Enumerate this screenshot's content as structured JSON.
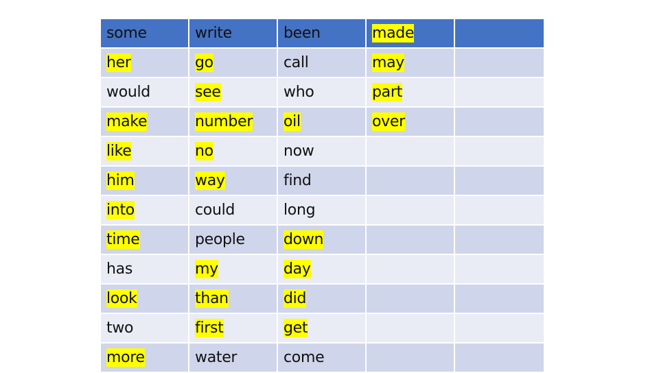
{
  "colors": {
    "header_bg": "#4472c4",
    "row_dark_bg": "#cfd5ea",
    "row_light_bg": "#e9ebf5",
    "highlight": "#ffff00"
  },
  "table": {
    "rows": [
      [
        {
          "text": "some",
          "hl": false
        },
        {
          "text": "write",
          "hl": false
        },
        {
          "text": "been",
          "hl": false
        },
        {
          "text": "made",
          "hl": true
        },
        {
          "text": "",
          "hl": false
        }
      ],
      [
        {
          "text": "her",
          "hl": true
        },
        {
          "text": "go",
          "hl": true
        },
        {
          "text": "call",
          "hl": false
        },
        {
          "text": "may",
          "hl": true
        },
        {
          "text": "",
          "hl": false
        }
      ],
      [
        {
          "text": "would",
          "hl": false
        },
        {
          "text": "see",
          "hl": true
        },
        {
          "text": "who",
          "hl": false
        },
        {
          "text": "part",
          "hl": true
        },
        {
          "text": "",
          "hl": false
        }
      ],
      [
        {
          "text": "make",
          "hl": true
        },
        {
          "text": "number",
          "hl": true
        },
        {
          "text": "oil",
          "hl": true
        },
        {
          "text": "over",
          "hl": true
        },
        {
          "text": "",
          "hl": false
        }
      ],
      [
        {
          "text": "like",
          "hl": true
        },
        {
          "text": "no",
          "hl": true
        },
        {
          "text": "now",
          "hl": false
        },
        {
          "text": "",
          "hl": false
        },
        {
          "text": "",
          "hl": false
        }
      ],
      [
        {
          "text": "him",
          "hl": true
        },
        {
          "text": "way",
          "hl": true
        },
        {
          "text": "find",
          "hl": false
        },
        {
          "text": "",
          "hl": false
        },
        {
          "text": "",
          "hl": false
        }
      ],
      [
        {
          "text": "into",
          "hl": true
        },
        {
          "text": "could",
          "hl": false
        },
        {
          "text": "long",
          "hl": false
        },
        {
          "text": "",
          "hl": false
        },
        {
          "text": "",
          "hl": false
        }
      ],
      [
        {
          "text": "time",
          "hl": true
        },
        {
          "text": "people",
          "hl": false
        },
        {
          "text": "down",
          "hl": true
        },
        {
          "text": "",
          "hl": false
        },
        {
          "text": "",
          "hl": false
        }
      ],
      [
        {
          "text": "has",
          "hl": false
        },
        {
          "text": "my",
          "hl": true
        },
        {
          "text": "day",
          "hl": true
        },
        {
          "text": "",
          "hl": false
        },
        {
          "text": "",
          "hl": false
        }
      ],
      [
        {
          "text": "look",
          "hl": true
        },
        {
          "text": "than",
          "hl": true
        },
        {
          "text": "did",
          "hl": true
        },
        {
          "text": "",
          "hl": false
        },
        {
          "text": "",
          "hl": false
        }
      ],
      [
        {
          "text": "two",
          "hl": false
        },
        {
          "text": "first",
          "hl": true
        },
        {
          "text": "get",
          "hl": true
        },
        {
          "text": "",
          "hl": false
        },
        {
          "text": "",
          "hl": false
        }
      ],
      [
        {
          "text": "more",
          "hl": true
        },
        {
          "text": "water",
          "hl": false
        },
        {
          "text": "come",
          "hl": false
        },
        {
          "text": "",
          "hl": false
        },
        {
          "text": "",
          "hl": false
        }
      ]
    ]
  }
}
